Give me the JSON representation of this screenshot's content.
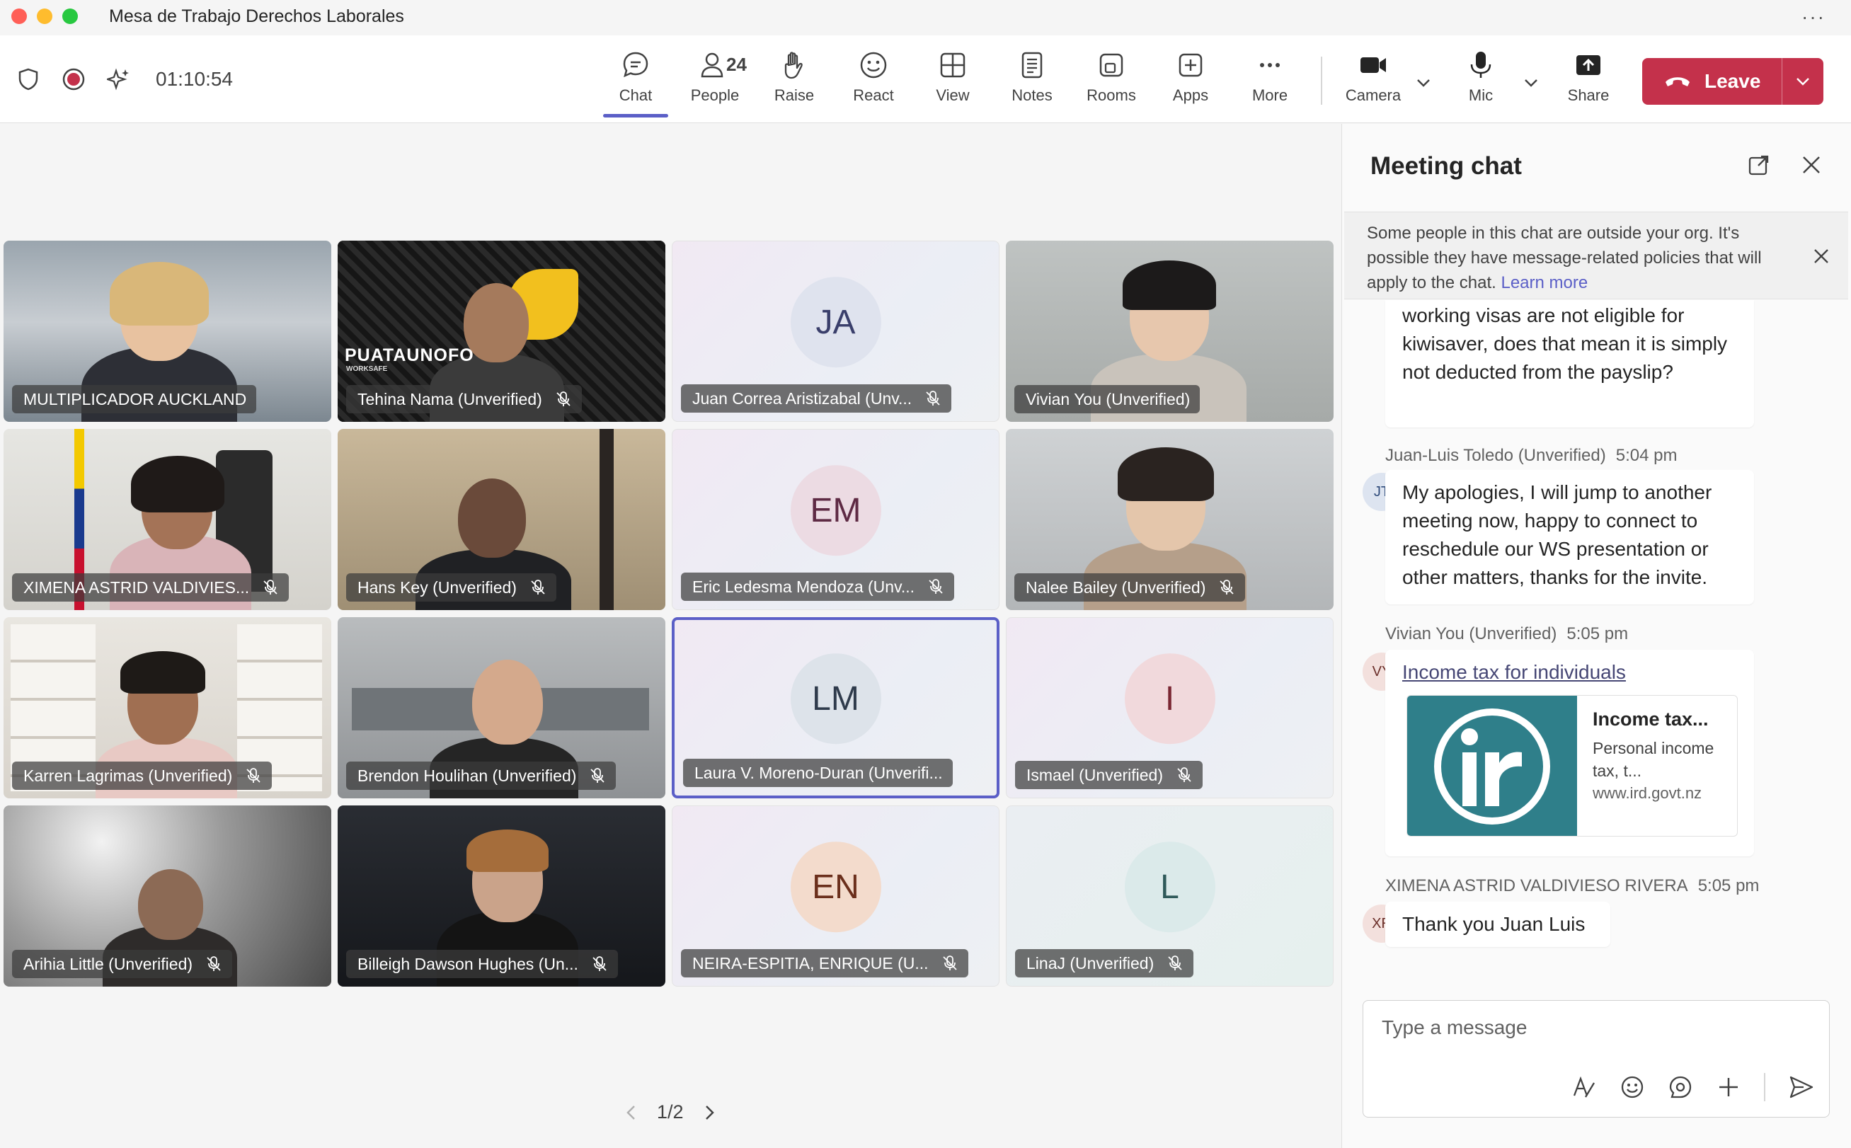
{
  "window": {
    "title": "Mesa de Trabajo Derechos Laborales",
    "more_label": "···"
  },
  "toolbar": {
    "timer": "01:10:54",
    "buttons": {
      "chat": "Chat",
      "people": "People",
      "people_count": "24",
      "raise": "Raise",
      "react": "React",
      "view": "View",
      "notes": "Notes",
      "rooms": "Rooms",
      "apps": "Apps",
      "more": "More",
      "camera": "Camera",
      "mic": "Mic",
      "share": "Share"
    },
    "leave": "Leave",
    "accent": "#5b5fc7",
    "leave_color": "#c4314b"
  },
  "participants": [
    {
      "name": "MULTIPLICADOR AUCKLAND",
      "muted": false,
      "type": "video"
    },
    {
      "name": "Tehina Nama (Unverified)",
      "muted": true,
      "type": "video",
      "overlay_text": "PUATAUNOFO",
      "overlay_sub": "WORKSAFE"
    },
    {
      "name": "Juan Correa Aristizabal (Unv...",
      "muted": true,
      "type": "avatar",
      "initials": "JA"
    },
    {
      "name": "Vivian You (Unverified)",
      "muted": false,
      "type": "video"
    },
    {
      "name": "XIMENA ASTRID VALDIVIES...",
      "muted": true,
      "type": "video"
    },
    {
      "name": "Hans Key (Unverified)",
      "muted": true,
      "type": "video"
    },
    {
      "name": "Eric Ledesma Mendoza (Unv...",
      "muted": true,
      "type": "avatar",
      "initials": "EM"
    },
    {
      "name": "Nalee Bailey (Unverified)",
      "muted": true,
      "type": "video"
    },
    {
      "name": "Karren Lagrimas (Unverified)",
      "muted": true,
      "type": "video"
    },
    {
      "name": "Brendon Houlihan (Unverified)",
      "muted": true,
      "type": "video"
    },
    {
      "name": "Laura V. Moreno-Duran (Unverifi...",
      "muted": false,
      "type": "avatar",
      "initials": "LM",
      "selected": true
    },
    {
      "name": "Ismael (Unverified)",
      "muted": true,
      "type": "avatar",
      "initials": "I"
    },
    {
      "name": "Arihia Little (Unverified)",
      "muted": true,
      "type": "video"
    },
    {
      "name": "Billeigh Dawson Hughes (Un...",
      "muted": true,
      "type": "video"
    },
    {
      "name": "NEIRA-ESPITIA, ENRIQUE (U...",
      "muted": true,
      "type": "avatar",
      "initials": "EN"
    },
    {
      "name": "LinaJ (Unverified)",
      "muted": true,
      "type": "avatar",
      "initials": "L"
    }
  ],
  "pager": {
    "label": "1/2"
  },
  "chat": {
    "title": "Meeting chat",
    "notice": {
      "text": "Some people in this chat are outside your org. It's possible they have message-related policies that will apply to the chat.",
      "link": "Learn more"
    },
    "messages": [
      {
        "text": "working visas are not eligible for kiwisaver, does that mean it is simply not deducted from the payslip?"
      },
      {
        "author": "Juan-Luis Toledo (Unverified)",
        "time": "5:04 pm",
        "initials": "JT",
        "text": "My apologies, I will jump to another meeting now, happy to connect to reschedule our WS presentation or other matters, thanks for the invite."
      },
      {
        "author": "Vivian You (Unverified)",
        "time": "5:05 pm",
        "initials": "VY",
        "link": "Income tax for individuals",
        "card": {
          "title": "Income tax...",
          "description": "Personal income tax, t...",
          "url": "www.ird.govt.nz"
        }
      },
      {
        "author": "XIMENA ASTRID VALDIVIESO RIVERA",
        "time": "5:05 pm",
        "initials": "XR",
        "text": "Thank you Juan Luis"
      }
    ],
    "compose_placeholder": "Type a message"
  }
}
